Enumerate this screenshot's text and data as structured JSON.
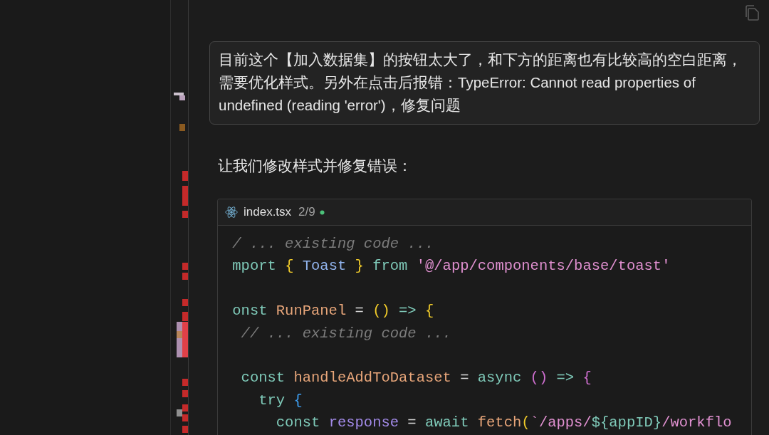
{
  "chat": {
    "user_message": "目前这个【加入数据集】的按钮太大了，和下方的距离也有比较高的空白距离，需要优化样式。另外在点击后报错：TypeError: Cannot read properties of undefined (reading 'error')，修复问题",
    "reply": "让我们修改样式并修复错误：",
    "code_block": {
      "filename": "index.tsx",
      "counter": "2/9",
      "lines": [
        {
          "kind": "code",
          "tokens": [
            {
              "kind": "comment",
              "text": " / ... existing code ..."
            }
          ]
        },
        {
          "kind": "code",
          "tokens": [
            {
              "kind": "keyword",
              "text": " mport "
            },
            {
              "kind": "brace",
              "text": "{ "
            },
            {
              "kind": "ident",
              "text": "Toast"
            },
            {
              "kind": "brace",
              "text": " } "
            },
            {
              "kind": "keyword",
              "text": "from "
            },
            {
              "kind": "string",
              "text": "'@/app/components/base/toast'"
            }
          ]
        },
        {
          "kind": "blank"
        },
        {
          "kind": "code",
          "tokens": [
            {
              "kind": "keyword",
              "text": " onst "
            },
            {
              "kind": "function",
              "text": "RunPanel"
            },
            {
              "kind": "plain",
              "text": " = "
            },
            {
              "kind": "brace",
              "text": "()"
            },
            {
              "kind": "keyword",
              "text": " => "
            },
            {
              "kind": "brace",
              "text": "{"
            }
          ]
        },
        {
          "kind": "code",
          "tokens": [
            {
              "kind": "comment",
              "text": "  // ... existing code ..."
            }
          ]
        },
        {
          "kind": "blank"
        },
        {
          "kind": "code",
          "tokens": [
            {
              "kind": "keyword",
              "text": "  const "
            },
            {
              "kind": "function",
              "text": "handleAddToDataset"
            },
            {
              "kind": "plain",
              "text": " = "
            },
            {
              "kind": "keyword",
              "text": "async "
            },
            {
              "kind": "paren",
              "text": "()"
            },
            {
              "kind": "keyword",
              "text": " => "
            },
            {
              "kind": "paren",
              "text": "{"
            }
          ]
        },
        {
          "kind": "code",
          "tokens": [
            {
              "kind": "keyword",
              "text": "    try "
            },
            {
              "kind": "bracket",
              "text": "{"
            }
          ]
        },
        {
          "kind": "code",
          "tokens": [
            {
              "kind": "keyword",
              "text": "      const "
            },
            {
              "kind": "variable",
              "text": "response"
            },
            {
              "kind": "plain",
              "text": " = "
            },
            {
              "kind": "keyword",
              "text": "await "
            },
            {
              "kind": "function",
              "text": "fetch"
            },
            {
              "kind": "brace",
              "text": "("
            },
            {
              "kind": "string",
              "text": "`/apps/"
            },
            {
              "kind": "keyword",
              "text": "${appID}"
            },
            {
              "kind": "string",
              "text": "/workflo"
            }
          ]
        }
      ]
    }
  }
}
